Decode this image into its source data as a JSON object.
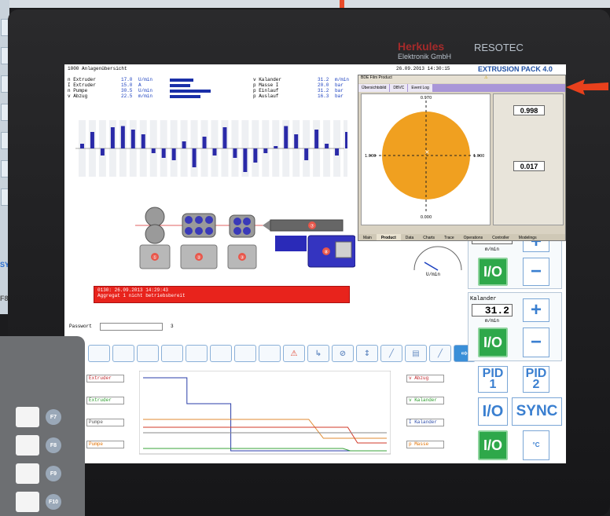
{
  "brand": {
    "name1": "Herkules",
    "name2": "RESOTEC",
    "sub": "Elektronik GmbH"
  },
  "header": {
    "title": "1000 Anlagenübersicht",
    "datetime": "26.09.2013  14:30:15",
    "product": "EXTRUSION PACK 4.0"
  },
  "values_left": [
    {
      "name": "n Extruder",
      "value": "17.0",
      "unit": "U/min",
      "bar_fraction": 0.55
    },
    {
      "name": "I Extruder",
      "value": "15.0",
      "unit": "A",
      "bar_fraction": 0.48
    },
    {
      "name": "n Pumpe",
      "value": "30.5",
      "unit": "U/min",
      "bar_fraction": 0.95
    },
    {
      "name": "v Abzug",
      "value": "22.5",
      "unit": "m/min",
      "bar_fraction": 0.7
    }
  ],
  "values_right": [
    {
      "name": "v Kalander",
      "value": "31.2",
      "unit": "m/min"
    },
    {
      "name": "p Masse I",
      "value": "20.0",
      "unit": "bar"
    },
    {
      "name": "p Einlauf",
      "value": "31.2",
      "unit": "bar"
    },
    {
      "name": "p Auslauf",
      "value": "16.3",
      "unit": "bar"
    }
  ],
  "profile_bars": [
    0.2,
    0.7,
    -0.3,
    0.9,
    0.95,
    0.8,
    0.6,
    -0.2,
    -0.4,
    -0.5,
    0.3,
    -0.8,
    0.5,
    -0.3,
    0.9,
    -0.4,
    -1.0,
    -0.6,
    -0.2,
    0.1,
    0.95,
    0.6,
    -0.5,
    0.8,
    0.2,
    -0.3,
    0.7
  ],
  "machine_labels": [
    "①",
    "②",
    "③",
    "⑦",
    "⑧"
  ],
  "alarm": {
    "line1": "0130: 26.09.2013 14:29:43",
    "line2": "Aggregat 1 nicht betriebsbereit"
  },
  "password": {
    "label": "Passwort",
    "value": "",
    "level": "3"
  },
  "toolbar_icons": [
    "",
    "",
    "",
    "",
    "",
    "",
    "",
    "",
    "⚠",
    "↳",
    "⊘",
    "↕",
    "╱",
    "▤",
    "╱",
    "⇨"
  ],
  "trend_legends_left": [
    {
      "label": "Extruder",
      "color": "red"
    },
    {
      "label": "Extruder",
      "color": "green"
    },
    {
      "label": "Pumpe",
      "color": "grey"
    },
    {
      "label": "Pumpe",
      "color": "orange"
    }
  ],
  "trend_legends_right": [
    {
      "label": "v Abzug",
      "color": "red"
    },
    {
      "label": "v Kalander",
      "color": "green"
    },
    {
      "label": "I Kalander",
      "color": "blue"
    },
    {
      "label": "p Masse",
      "color": "orange"
    }
  ],
  "trend_series": [
    {
      "name": "blue",
      "color": "#2a3ea8",
      "points": [
        [
          0,
          0.95
        ],
        [
          0.18,
          0.95
        ],
        [
          0.18,
          0.62
        ],
        [
          0.36,
          0.62
        ],
        [
          0.36,
          0.02
        ],
        [
          1,
          0.02
        ]
      ]
    },
    {
      "name": "orange",
      "color": "#e08a30",
      "points": [
        [
          0,
          0.42
        ],
        [
          0.68,
          0.42
        ],
        [
          0.74,
          0.18
        ],
        [
          1,
          0.18
        ]
      ]
    },
    {
      "name": "red",
      "color": "#d23a2a",
      "points": [
        [
          0,
          0.32
        ],
        [
          0.84,
          0.32
        ],
        [
          0.88,
          0.12
        ],
        [
          1,
          0.12
        ]
      ]
    },
    {
      "name": "grey",
      "color": "#888888",
      "points": [
        [
          0,
          0.25
        ],
        [
          1,
          0.25
        ]
      ]
    },
    {
      "name": "green",
      "color": "#3aa33a",
      "points": [
        [
          0,
          0.05
        ],
        [
          0.82,
          0.05
        ],
        [
          0.85,
          0.02
        ],
        [
          1,
          0.02
        ]
      ]
    }
  ],
  "right_panel": {
    "top_value": "22.5",
    "top_unit": "m/min",
    "io_label": "I/O",
    "plus": "+",
    "minus": "−",
    "kalander_label": "Kalander",
    "kalander_value": "31.2",
    "kalander_unit": "m/min",
    "pid1": "PID\n1",
    "pid2": "PID\n2",
    "io2": "I/O",
    "sync": "SYNC",
    "temp_label": "°C",
    "gauge_unit": "U/min"
  },
  "popup": {
    "title": "BDE Film Product",
    "tabs": [
      "Übersichtsbild",
      "DBVC",
      "Event Log"
    ],
    "plot_top": "0.970",
    "plot_left": "1.000",
    "plot_right": "1.000",
    "plot_bottom": "0.000",
    "value1": "0.998",
    "value2": "0.017",
    "bottom_tabs": [
      "Main",
      "Product",
      "Data",
      "Charts",
      "Trace",
      "Operations",
      "Controller",
      "Modelings"
    ]
  },
  "left_sidebar": {
    "sync_text": "SYNC",
    "f8_text": "F8"
  },
  "fkeys": [
    "F7",
    "F8",
    "F9",
    "F10"
  ]
}
